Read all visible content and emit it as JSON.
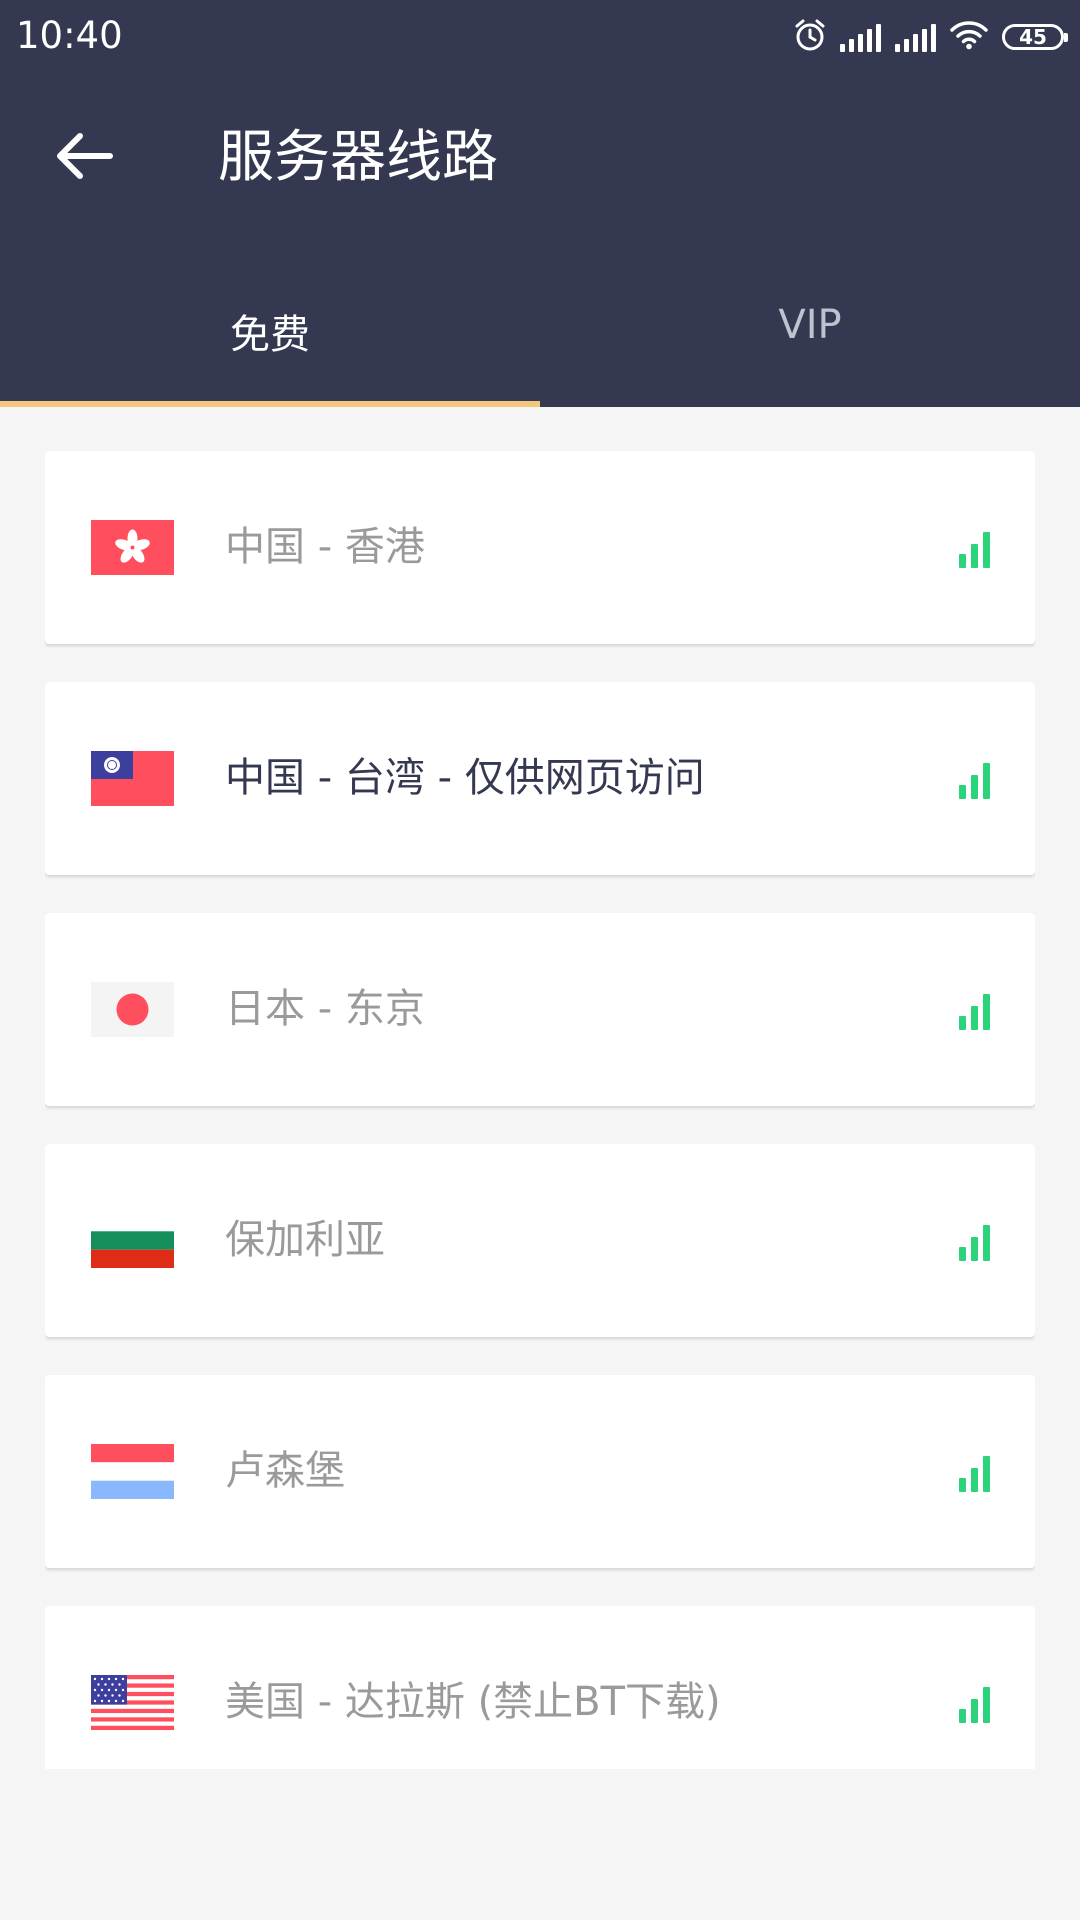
{
  "status_bar": {
    "time": "10:40",
    "battery": "45",
    "icons": [
      "alarm-icon",
      "cell-signal-icon",
      "cell-signal-icon",
      "wifi-icon",
      "battery-icon"
    ]
  },
  "app_bar": {
    "title": "服务器线路",
    "back_icon": "arrow-left-icon"
  },
  "tabs": [
    {
      "label": "免费",
      "active": true
    },
    {
      "label": "VIP",
      "active": false
    }
  ],
  "colors": {
    "header_bg": "#343850",
    "tab_indicator": "#f5c77e",
    "signal_green": "#2bd47b",
    "selected_text": "#343850",
    "default_text": "#9a9a9a"
  },
  "servers": [
    {
      "label": "中国 - 香港",
      "flag": "hong-kong-flag-icon",
      "selected": false,
      "signal_bars": 3
    },
    {
      "label": "中国 - 台湾 - 仅供网页访问",
      "flag": "taiwan-flag-icon",
      "selected": true,
      "signal_bars": 3
    },
    {
      "label": "日本 - 东京",
      "flag": "japan-flag-icon",
      "selected": false,
      "signal_bars": 3
    },
    {
      "label": "保加利亚",
      "flag": "bulgaria-flag-icon",
      "selected": false,
      "signal_bars": 3
    },
    {
      "label": "卢森堡",
      "flag": "luxembourg-flag-icon",
      "selected": false,
      "signal_bars": 3
    },
    {
      "label": "美国 - 达拉斯 (禁止BT下载)",
      "flag": "usa-flag-icon",
      "selected": false,
      "signal_bars": 3
    }
  ]
}
